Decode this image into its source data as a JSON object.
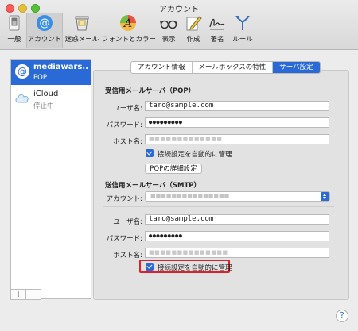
{
  "window": {
    "title": "アカウント"
  },
  "toolbar": {
    "items": [
      {
        "label": "一般",
        "icon": "switch-icon"
      },
      {
        "label": "アカウント",
        "icon": "at-icon"
      },
      {
        "label": "迷惑メール",
        "icon": "junk-mail-icon"
      },
      {
        "label": "フォントとカラー",
        "icon": "font-color-icon"
      },
      {
        "label": "表示",
        "icon": "glasses-icon"
      },
      {
        "label": "作成",
        "icon": "compose-icon"
      },
      {
        "label": "署名",
        "icon": "signature-icon"
      },
      {
        "label": "ルール",
        "icon": "rules-icon"
      }
    ],
    "active_index": 1
  },
  "sidebar": {
    "accounts": [
      {
        "name": "mediawars...",
        "type": "POP",
        "icon": "at-icon"
      },
      {
        "name": "iCloud",
        "type": "停止中",
        "icon": "cloud-icon"
      }
    ],
    "add_label": "+",
    "remove_label": "−"
  },
  "tabs": [
    {
      "label": "アカウント情報"
    },
    {
      "label": "メールボックスの特性"
    },
    {
      "label": "サーバ設定"
    }
  ],
  "incoming": {
    "section_title": "受信用メールサーバ（POP）",
    "username_label": "ユーザ名:",
    "username_value": "taro@sample.com",
    "password_label": "パスワード:",
    "password_value": "●●●●●●●●●",
    "host_label": "ホスト名:",
    "host_value": "■■■■■■■■■■■■■",
    "auto_manage_label": "接続設定を自動的に管理",
    "auto_manage_checked": true,
    "details_button": "POPの詳細設定"
  },
  "outgoing": {
    "section_title": "送信用メールサーバ（SMTP）",
    "account_label": "アカウント:",
    "account_value": "■■■■■■■■■■■■■■■",
    "username_label": "ユーザ名:",
    "username_value": "taro@sample.com",
    "password_label": "パスワード:",
    "password_value": "●●●●●●●●●",
    "host_label": "ホスト名:",
    "host_value": "■■■■■■■■■■■■■■",
    "auto_manage_label": "接続設定を自動的に管理",
    "auto_manage_checked": true
  },
  "help_label": "?",
  "colors": {
    "accent": "#2a6ad6",
    "highlight": "#e1202a"
  }
}
